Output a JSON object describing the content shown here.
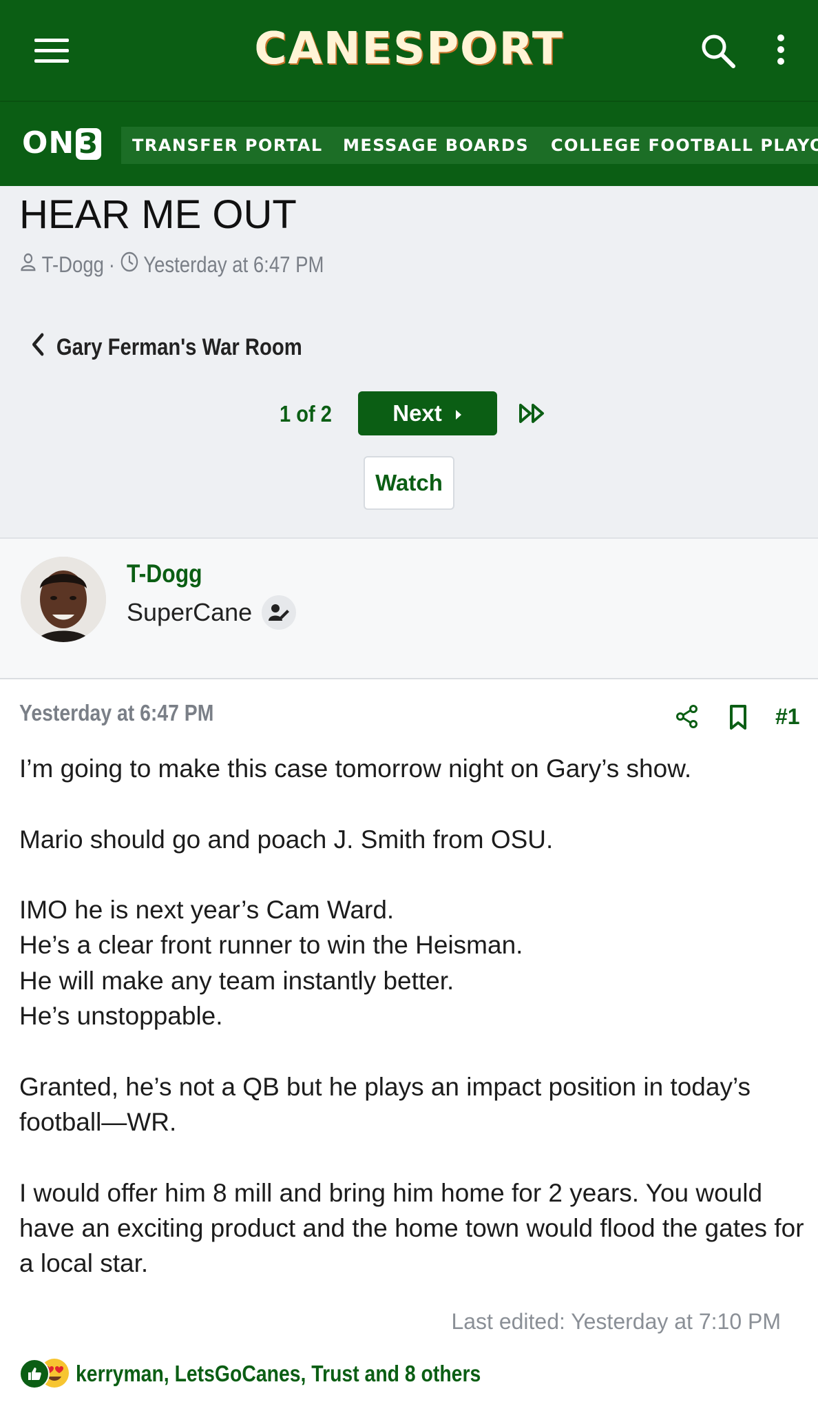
{
  "header": {
    "brand": "CANESPORT"
  },
  "nav": {
    "logo": "ON3",
    "tabs": [
      "TRANSFER PORTAL",
      "MESSAGE BOARDS",
      "COLLEGE FOOTBALL PLAYOFF"
    ]
  },
  "thread": {
    "title": "HEAR ME OUT",
    "author": "T-Dogg",
    "separator": "·",
    "time": "Yesterday at 6:47 PM",
    "forum": "Gary Ferman's War Room",
    "page_count": "1 of 2",
    "next_label": "Next",
    "watch_label": "Watch"
  },
  "user": {
    "name": "T-Dogg",
    "title": "SuperCane"
  },
  "post": {
    "time": "Yesterday at 6:47 PM",
    "number": "#1",
    "lines": [
      "I’m going to make this case tomorrow night on Gary’s show.",
      "",
      "Mario should go and poach J. Smith from OSU.",
      "",
      "IMO he is next year’s Cam Ward.",
      "He’s a clear front runner to win the Heisman.",
      "He will make any team instantly better.",
      "He’s unstoppable.",
      "",
      "Granted, he’s not a QB but he plays an impact position in today’s football—WR.",
      "",
      "I would offer him 8 mill and bring him home for 2 years. You would have an exciting product and the home town would flood the gates for a local star."
    ],
    "last_edited": "Last edited: Yesterday at 7:10 PM",
    "reactions_text": "kerryman, LetsGoCanes, Trust and 8 others"
  },
  "colors": {
    "brand_green": "#0b5e14",
    "header_bg": "#0b5e14",
    "page_bg": "#eef0f3",
    "muted_text": "#7a7f87"
  }
}
